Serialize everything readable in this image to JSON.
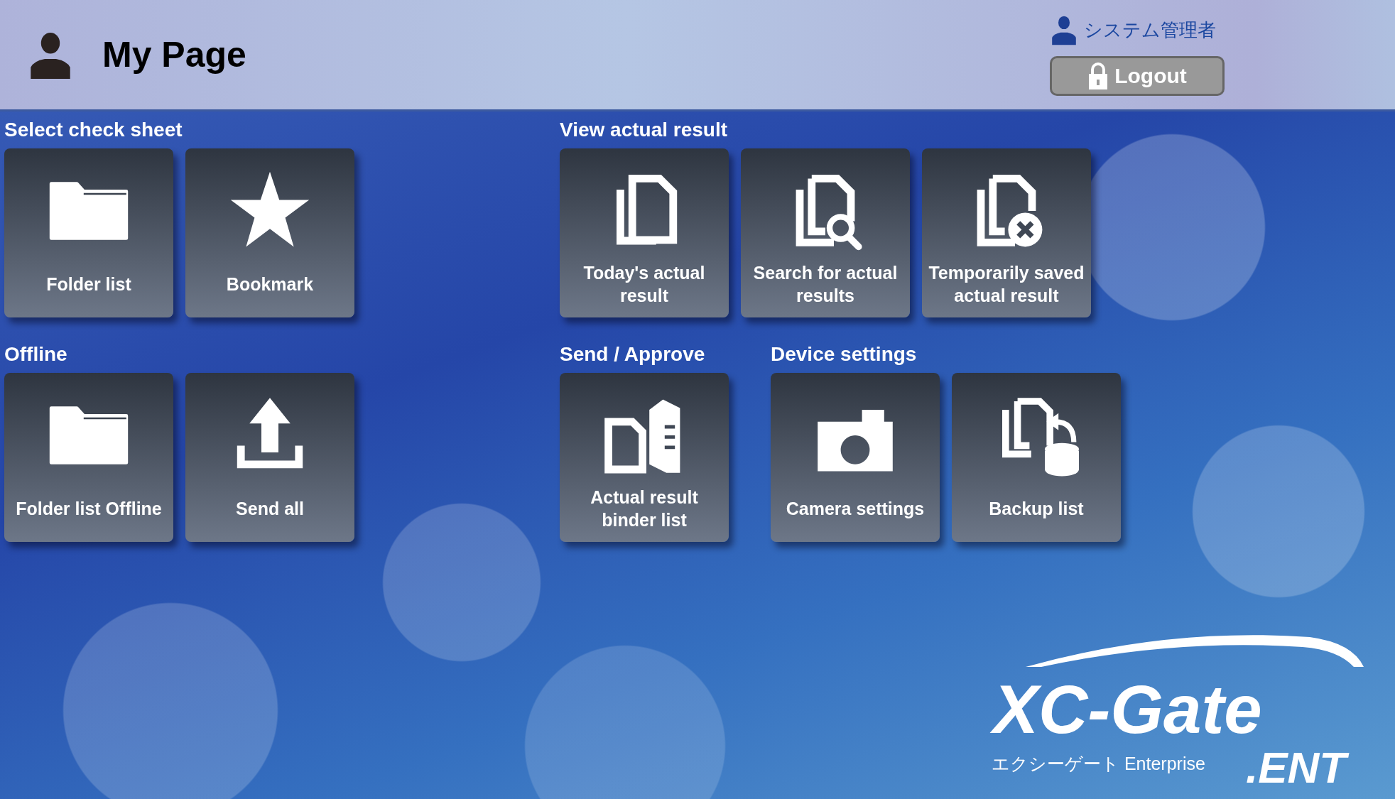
{
  "header": {
    "title": "My Page",
    "user": "システム管理者",
    "logout": "Logout"
  },
  "rows": [
    {
      "groups": [
        {
          "title": "Select check sheet",
          "tiles": [
            {
              "kind": "folder",
              "label": "Folder list"
            },
            {
              "kind": "star",
              "label": "Bookmark"
            }
          ]
        },
        {
          "title": "View actual result",
          "tiles": [
            {
              "kind": "docs",
              "label": "Today's actual result"
            },
            {
              "kind": "doc-search",
              "label": "Search for actual results"
            },
            {
              "kind": "doc-cancel",
              "label": "Temporarily saved actual result"
            }
          ]
        }
      ]
    },
    {
      "groups": [
        {
          "title": "Offline",
          "tiles": [
            {
              "kind": "folder",
              "label": "Folder list Offline"
            },
            {
              "kind": "upload",
              "label": "Send all"
            }
          ]
        },
        {
          "title": "Send / Approve",
          "tiles": [
            {
              "kind": "binder",
              "label": "Actual result binder list"
            }
          ]
        },
        {
          "title": "Device settings",
          "tiles": [
            {
              "kind": "camera",
              "label": "Camera settings"
            },
            {
              "kind": "backup",
              "label": "Backup list"
            }
          ]
        }
      ]
    }
  ],
  "logo": {
    "name": "XC-Gate",
    "subtitle": "エクシーゲート Enterprise",
    "edition": ".ENT"
  }
}
